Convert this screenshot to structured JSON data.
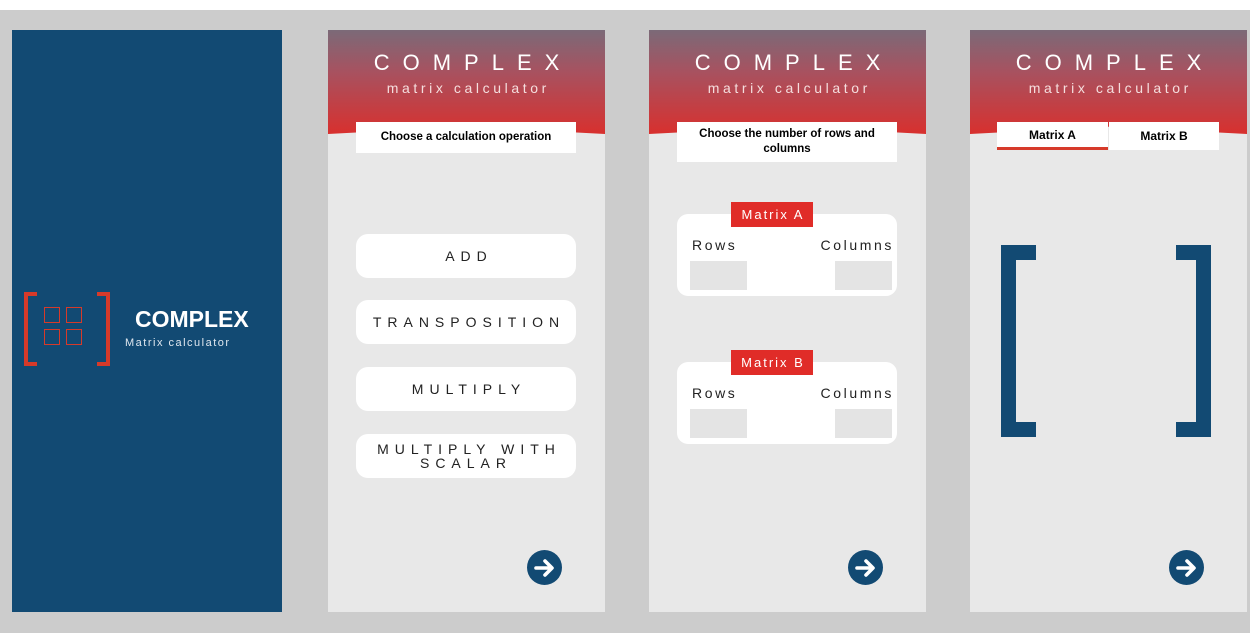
{
  "splash": {
    "title": "COMPLEX",
    "subtitle": "Matrix calculator",
    "logo_icon": "matrix-bracket-grid-icon"
  },
  "header": {
    "title": "COMPLEX",
    "subtitle": "matrix calculator"
  },
  "screen_operations": {
    "instruction": "Choose a calculation operation",
    "operations": [
      {
        "label": "ADD"
      },
      {
        "label": "TRANSPOSITION"
      },
      {
        "label": "MULTIPLY"
      },
      {
        "label": "MULTIPLY WITH SCALAR"
      }
    ],
    "next_icon": "arrow-right-circle-icon"
  },
  "screen_dimensions": {
    "instruction": "Choose the number of rows and columns",
    "matrix_a": {
      "label": "Matrix A",
      "rows_label": "Rows",
      "columns_label": "Columns",
      "rows_value": "",
      "columns_value": ""
    },
    "matrix_b": {
      "label": "Matrix B",
      "rows_label": "Rows",
      "columns_label": "Columns",
      "rows_value": "",
      "columns_value": ""
    }
  },
  "screen_input": {
    "tabs": [
      {
        "label": "Matrix A",
        "active": true
      },
      {
        "label": "Matrix B",
        "active": false
      }
    ]
  },
  "colors": {
    "brand_blue": "#124a73",
    "accent_red": "#d63a2a",
    "background": "#e8e8e8"
  }
}
